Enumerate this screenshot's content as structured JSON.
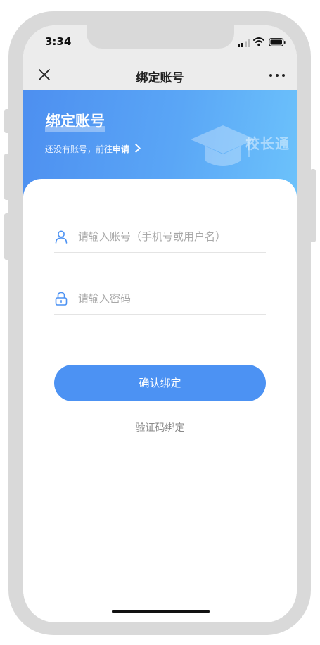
{
  "status": {
    "time": "3:34"
  },
  "nav": {
    "title": "绑定账号"
  },
  "banner": {
    "title": "绑定账号",
    "subtitle_prefix": "还没有账号，前往",
    "apply_link": "申请",
    "logo_text": "校长通"
  },
  "form": {
    "account_placeholder": "请输入账号（手机号或用户名）",
    "password_placeholder": "请输入密码",
    "confirm_label": "确认绑定",
    "code_bind_label": "验证码绑定"
  },
  "colors": {
    "primary": "#4c92f3",
    "banner_start": "#4d8ff0",
    "banner_end": "#6cc2fb"
  }
}
